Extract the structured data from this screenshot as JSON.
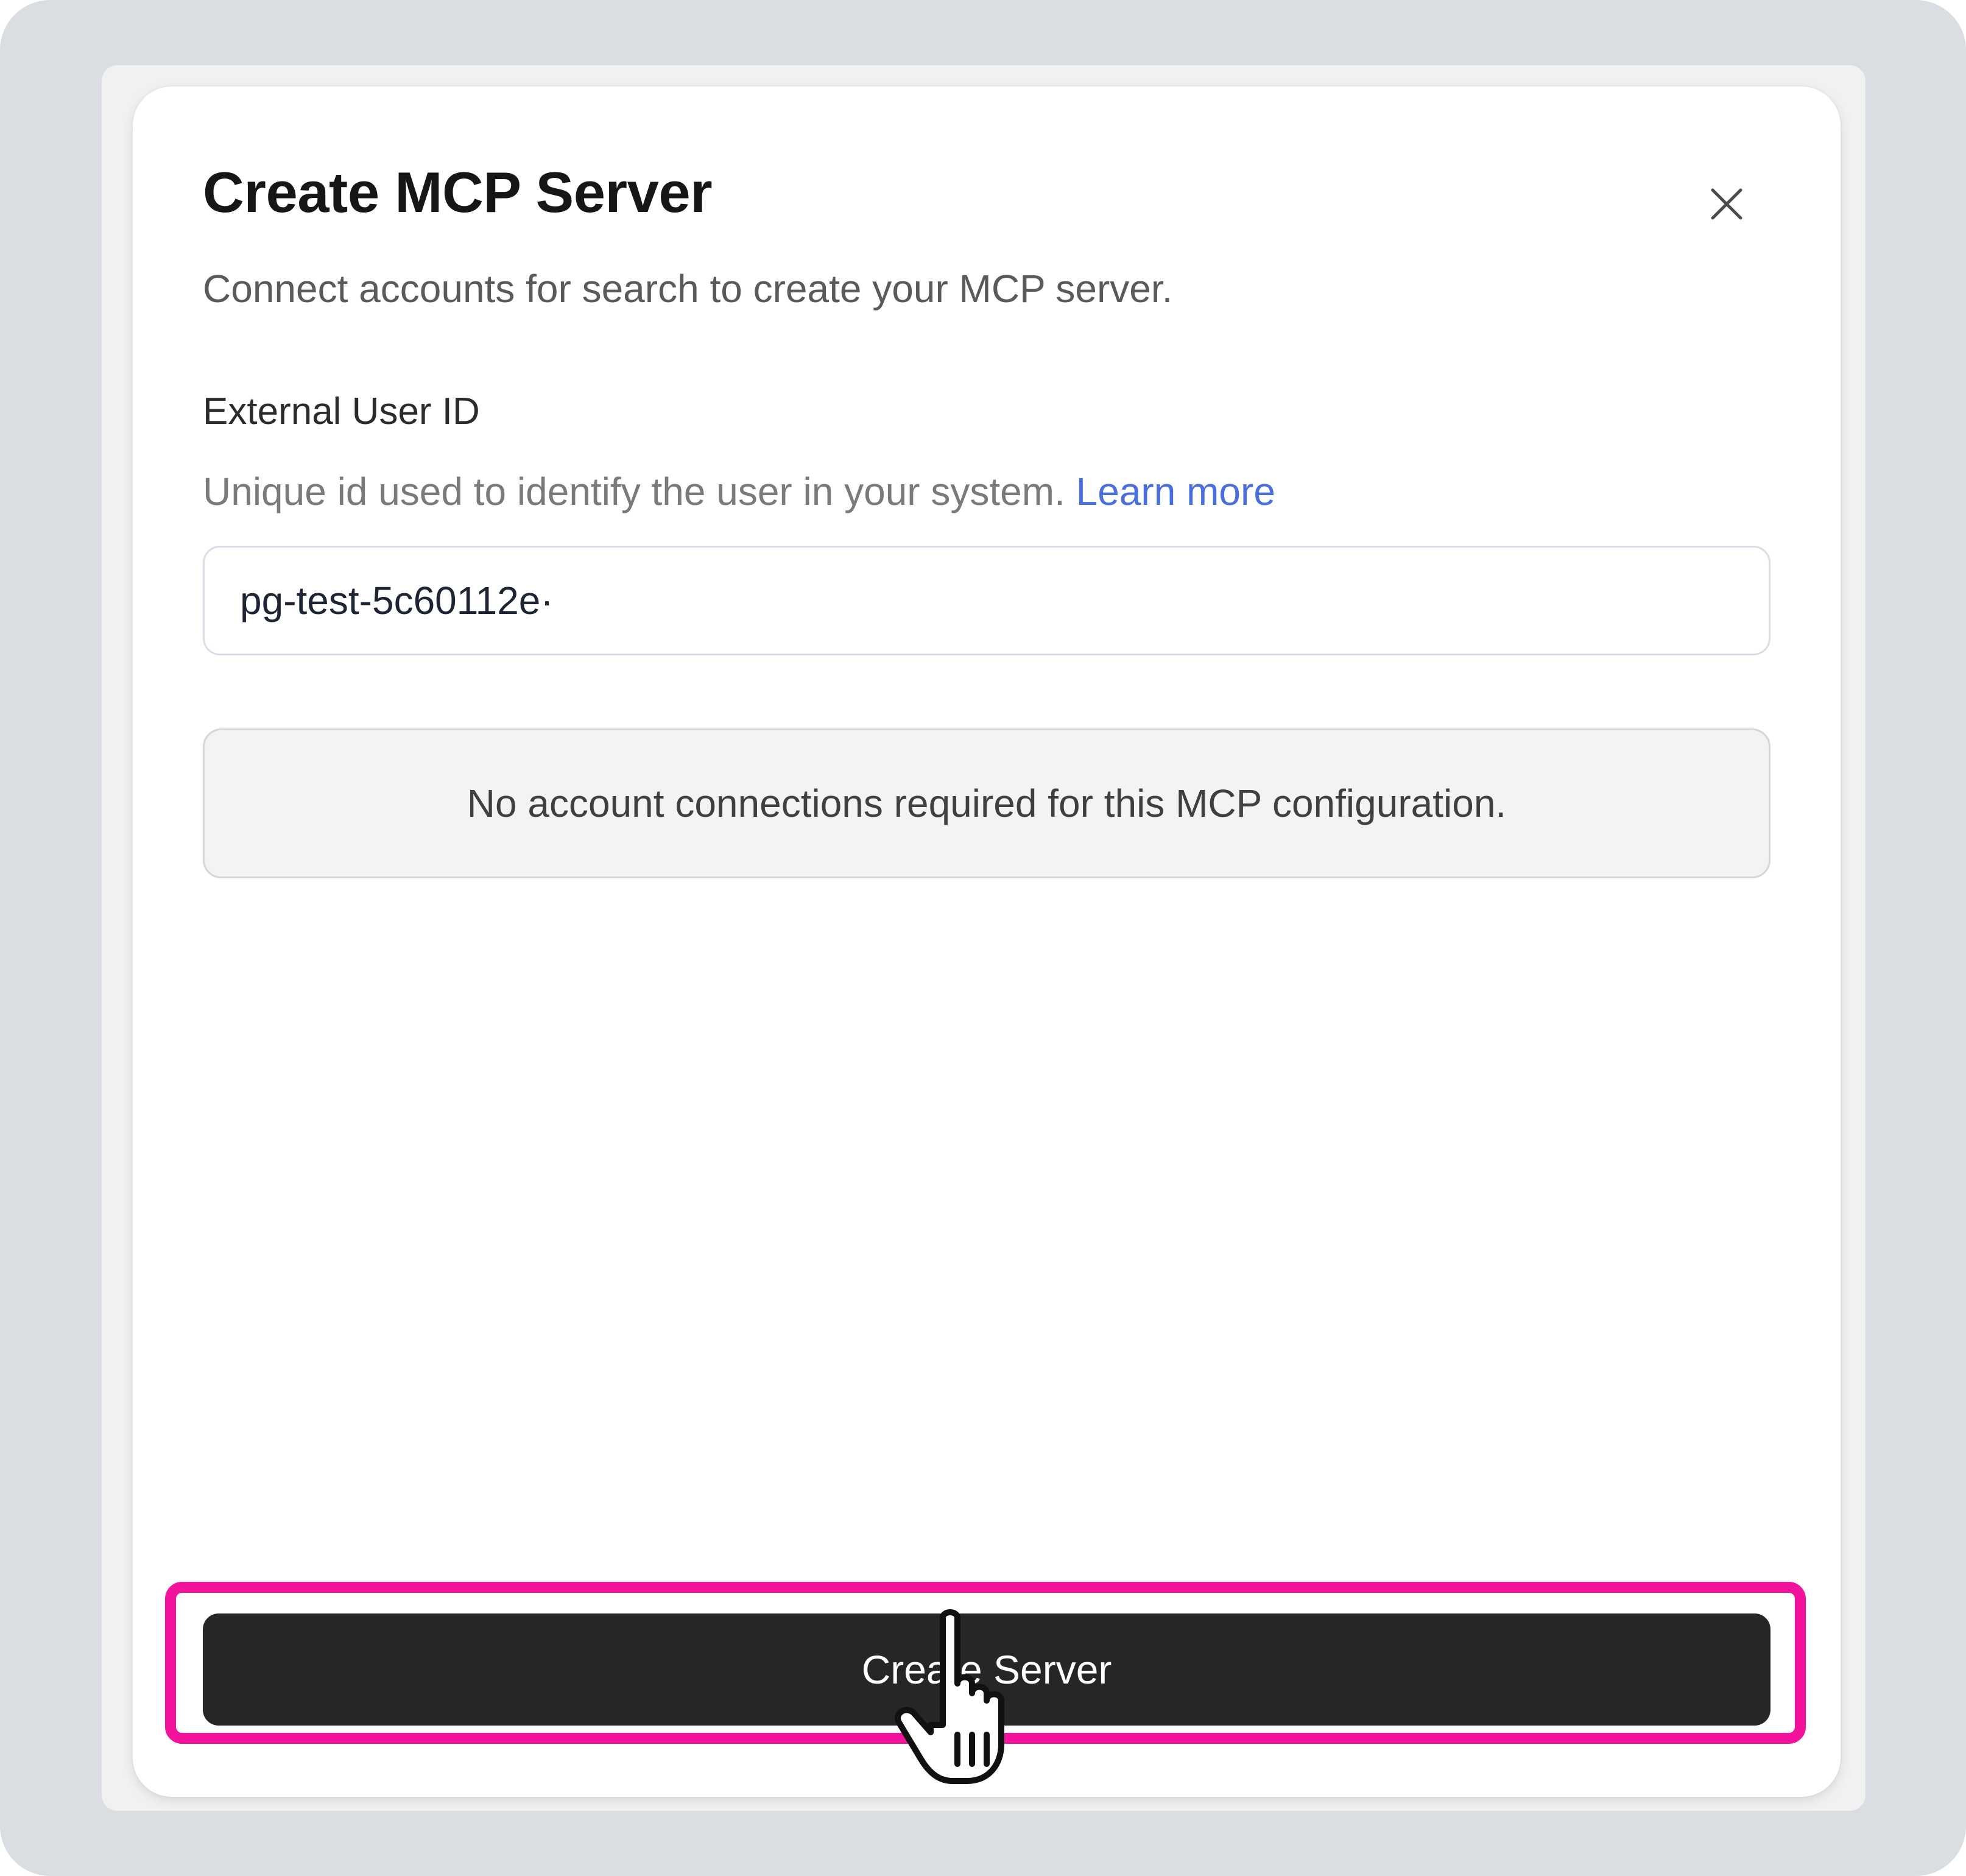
{
  "dialog": {
    "title": "Create MCP Server",
    "description": "Connect accounts for search to create your MCP server.",
    "close_icon": "close-icon"
  },
  "external_user_id": {
    "label": "External User ID",
    "help_text": "Unique id used to identify the user in your system.",
    "help_link": "Learn more",
    "value": "pg-test-5c60112e·"
  },
  "connections": {
    "message": "No account connections required for this MCP configuration."
  },
  "actions": {
    "create_label": "Create Server"
  },
  "overlay": {
    "highlight_color": "#f3129c",
    "cursor_icon": "hand-pointer-icon"
  },
  "colors": {
    "link": "#4a6ee0",
    "primary_button": "#262626",
    "info_background": "#f4f3f1"
  }
}
